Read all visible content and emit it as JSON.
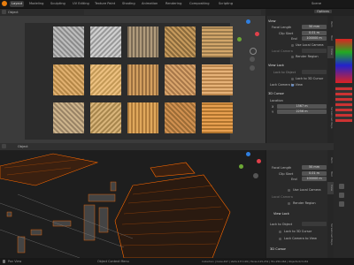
{
  "topbar": {
    "tabs": [
      "Layout",
      "Modeling",
      "Sculpting",
      "UV Editing",
      "Texture Paint",
      "Shading",
      "Animation",
      "Rendering",
      "Compositing",
      "Scripting"
    ],
    "scene": "Scene",
    "options": "Options"
  },
  "top_viewport": {
    "mode": "Object",
    "shading": "Solid"
  },
  "top_panel": {
    "view_header": "View",
    "focal_length_label": "Focal Length",
    "focal_length": "50 mm",
    "clip_start_label": "Clip Start",
    "clip_start": "0.01 m",
    "end_label": "End",
    "end": "100000 m",
    "use_local_camera": "Use Local Camera",
    "local_camera_label": "Local Camera",
    "render_region": "Render Region",
    "view_lock_header": "View Lock",
    "lock_to_object_label": "Lock to Object",
    "lock_to_3d_cursor": "Lock to 3D Cursor",
    "lock_camera_to_view": "Lock Camera to View",
    "cursor_header": "3D Cursor",
    "location_label": "Location",
    "x_label": "X",
    "x_value": "1567 m",
    "y_label": "Y",
    "y_value": "2256 m"
  },
  "bottom_viewport": {
    "mode": "Object"
  },
  "bottom_panel": {
    "focal_length_label": "Focal Length",
    "focal_length": "50 mm",
    "clip_start_label": "Clip Start",
    "clip_start": "0.01 m",
    "end_label": "End",
    "end": "100000 m",
    "use_local_camera": "Use Local Camera",
    "local_camera_label": "Local Camera",
    "render_region": "Render Region",
    "view_lock_header": "View Lock",
    "lock_to_object": "Lock to Object",
    "lock_to_3d_cursor": "Lock to 3D Cursor",
    "lock_camera_to_view": "Lock Camera to View",
    "cursor_header": "3D Cursor"
  },
  "tool_tabs": [
    "Item",
    "Tool",
    "View",
    "Screencast Keys"
  ],
  "statusbar": {
    "left": "Pan View",
    "mid": "Object Context Menu",
    "right": "Collection | Cube.497 | Verts:137,190 | Faces:125,232 | Tris:250,464 | Objects:0/3,182"
  },
  "colors": {
    "accent": "#4772b3",
    "selection": "#ff6a00",
    "background": "#232323"
  }
}
